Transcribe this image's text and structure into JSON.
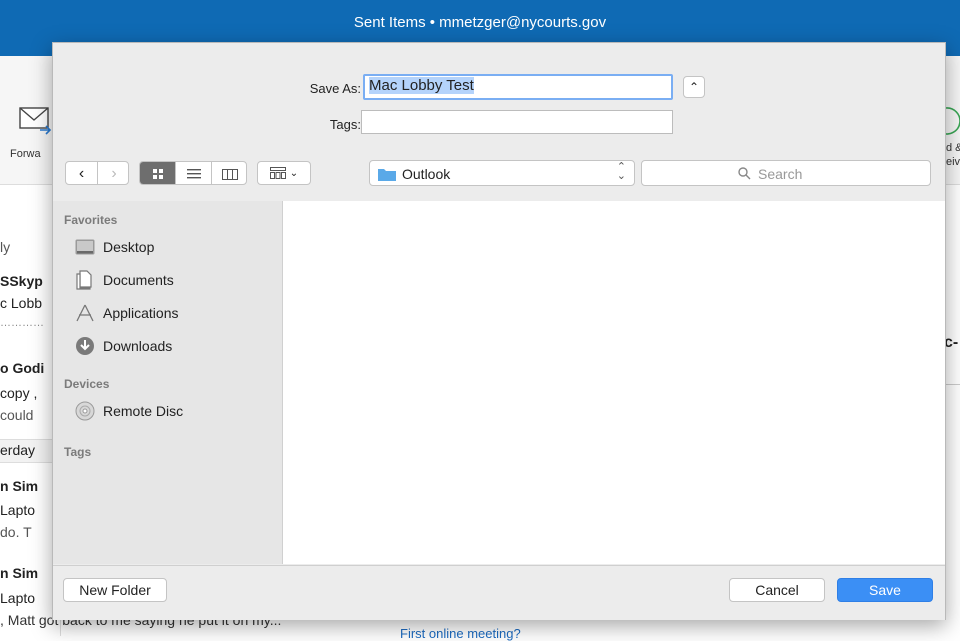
{
  "window": {
    "title": "Sent Items • mmetzger@nycourts.gov"
  },
  "ribbon": {
    "forward_label": "Forwa",
    "right_label_1": "d &",
    "right_label_2": "eive"
  },
  "message_list": {
    "lines": [
      "ly",
      "SSkyp",
      "c Lobb",
      "…………",
      "o Godi",
      "copy ,",
      "could",
      "erday",
      "n Sim",
      "Lapto",
      "do. T",
      "n Sim",
      "Lapto"
    ],
    "below_text": ", Matt got back to me saying he put it on my..."
  },
  "reading_pane": {
    "heading_fragment": "c-",
    "link_text": "First online meeting?"
  },
  "dialog": {
    "save_as_label": "Save As:",
    "save_as_value": "Mac Lobby Test",
    "tags_label": "Tags:",
    "tags_value": "",
    "location": "Outlook",
    "search_placeholder": "Search",
    "sidebar": {
      "favorites_header": "Favorites",
      "favorites": [
        {
          "label": "Desktop",
          "icon": "desktop-icon"
        },
        {
          "label": "Documents",
          "icon": "documents-icon"
        },
        {
          "label": "Applications",
          "icon": "applications-icon"
        },
        {
          "label": "Downloads",
          "icon": "downloads-icon"
        }
      ],
      "devices_header": "Devices",
      "devices": [
        {
          "label": "Remote Disc",
          "icon": "remote-disc-icon"
        }
      ],
      "tags_header": "Tags"
    },
    "new_folder_label": "New Folder",
    "cancel_label": "Cancel",
    "save_label": "Save",
    "accent_color": "#3b8ff5"
  }
}
